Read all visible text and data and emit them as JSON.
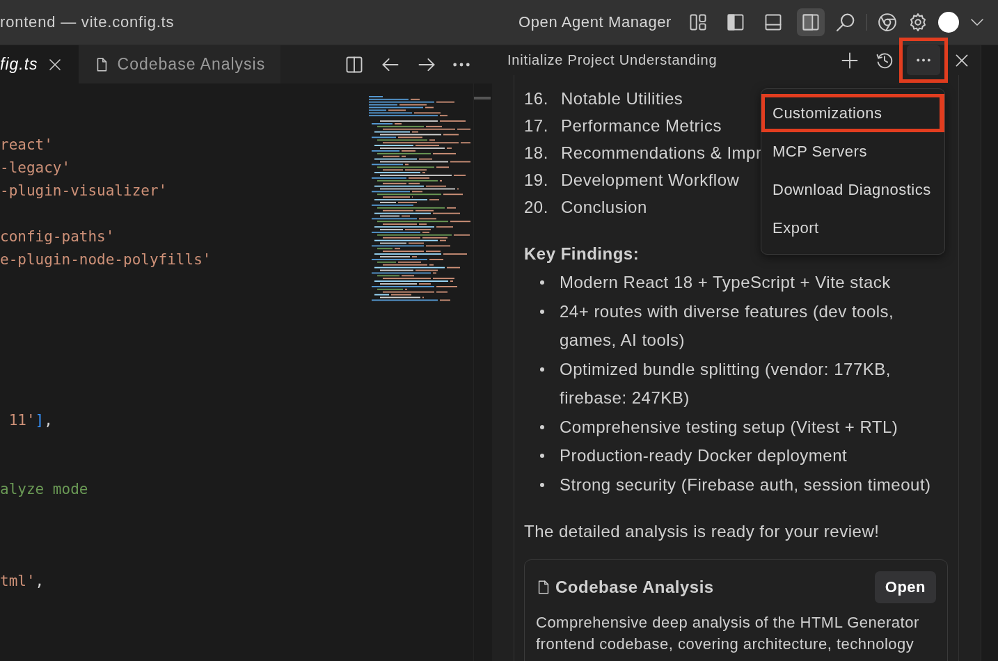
{
  "window": {
    "title": "rontend — vite.config.ts"
  },
  "titlebar": {
    "agent_manager": "Open Agent Manager",
    "layout_toggles": [
      {
        "kind": "grid",
        "selected": false
      },
      {
        "kind": "sidebar-left",
        "selected": false
      },
      {
        "kind": "panel-bottom",
        "selected": false
      },
      {
        "kind": "sidebar-right",
        "selected": true
      }
    ]
  },
  "editor": {
    "tabs": [
      {
        "label": "fig.ts",
        "selected": true,
        "preview": true
      },
      {
        "label": "Codebase Analysis",
        "selected": false,
        "preview": false
      }
    ],
    "lines": [
      {
        "kind": "code",
        "tokens": [
          {
            "kind": "string",
            "text": "react'"
          }
        ]
      },
      {
        "kind": "code",
        "tokens": [
          {
            "kind": "string",
            "text": "-legacy'"
          }
        ]
      },
      {
        "kind": "code",
        "tokens": [
          {
            "kind": "string",
            "text": "-plugin-visualizer'"
          }
        ]
      },
      {
        "kind": "blank"
      },
      {
        "kind": "code",
        "tokens": [
          {
            "kind": "string",
            "text": "config-paths'"
          }
        ]
      },
      {
        "kind": "code",
        "tokens": [
          {
            "kind": "string",
            "text": "e-plugin-node-polyfills'"
          }
        ]
      },
      {
        "kind": "blank"
      },
      {
        "kind": "blank"
      },
      {
        "kind": "blank"
      },
      {
        "kind": "blank"
      },
      {
        "kind": "blank"
      },
      {
        "kind": "blank"
      },
      {
        "kind": "code",
        "tokens": [
          {
            "kind": "string",
            "text": " 11'"
          },
          {
            "kind": "bracket",
            "text": "]"
          },
          {
            "kind": "punct",
            "text": ","
          }
        ]
      },
      {
        "kind": "blank"
      },
      {
        "kind": "blank"
      },
      {
        "kind": "code",
        "tokens": [
          {
            "kind": "comment",
            "text": "alyze mode"
          }
        ]
      },
      {
        "kind": "blank"
      },
      {
        "kind": "blank"
      },
      {
        "kind": "blank"
      },
      {
        "kind": "code",
        "tokens": [
          {
            "kind": "string",
            "text": "tml'"
          },
          {
            "kind": "punct",
            "text": ","
          }
        ]
      }
    ]
  },
  "chat": {
    "title": "Initialize Project Understanding",
    "more_highlighted": true,
    "menu": [
      {
        "label": "Customizations",
        "highlighted": true
      },
      {
        "label": "MCP Servers",
        "highlighted": false
      },
      {
        "label": "Download Diagnostics",
        "highlighted": false
      },
      {
        "label": "Export",
        "highlighted": false
      }
    ],
    "outline": [
      {
        "number": "16.",
        "text": "Notable Utilities"
      },
      {
        "number": "17.",
        "text": "Performance Metrics"
      },
      {
        "number": "18.",
        "text": "Recommendations & Impr"
      },
      {
        "number": "19.",
        "text": "Development Workflow"
      },
      {
        "number": "20.",
        "text": "Conclusion"
      }
    ],
    "findings_title": "Key Findings:",
    "findings": [
      "Modern React 18 + TypeScript + Vite stack",
      "24+ routes with diverse features (dev tools, games, AI tools)",
      "Optimized bundle splitting (vendor: 177KB, firebase: 247KB)",
      "Comprehensive testing setup (Vitest + RTL)",
      "Production-ready Docker deployment",
      "Strong security (Firebase auth, session timeout)"
    ],
    "summary": "The detailed analysis is ready for your review!",
    "card": {
      "title": "Codebase Analysis",
      "button": "Open",
      "description": "Comprehensive deep analysis of the HTML Generator frontend codebase, covering architecture, technology"
    }
  }
}
